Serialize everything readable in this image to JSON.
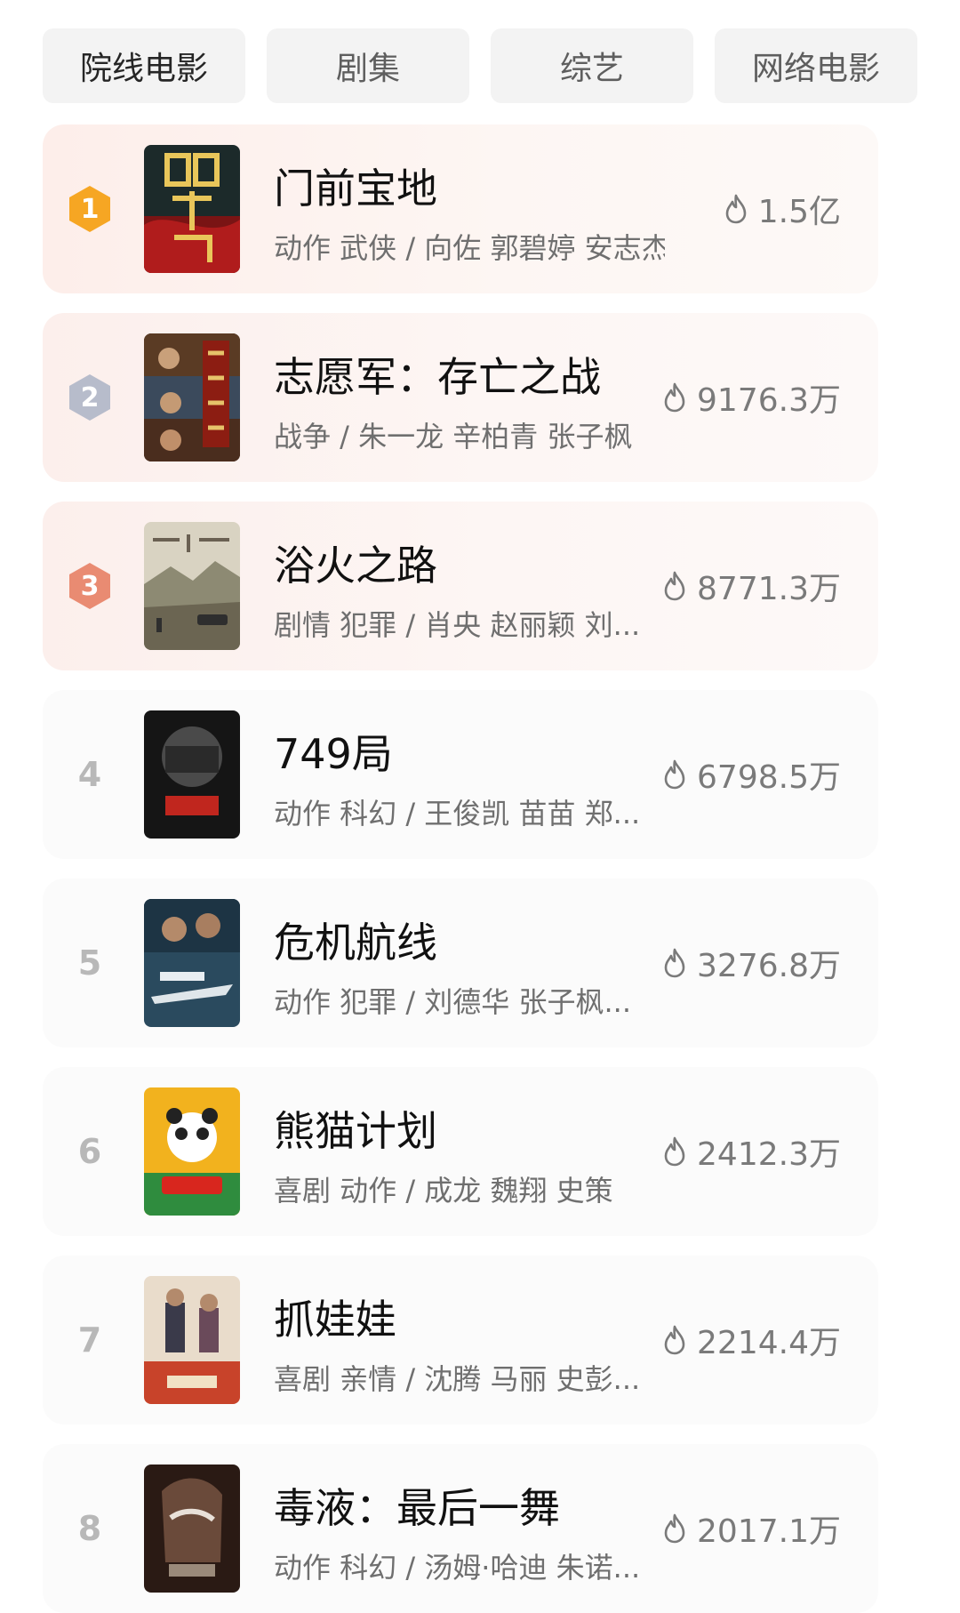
{
  "tabs": [
    {
      "label": "院线电影",
      "active": true
    },
    {
      "label": "剧集",
      "active": false
    },
    {
      "label": "综艺",
      "active": false
    },
    {
      "label": "网络电影",
      "active": false
    }
  ],
  "items": [
    {
      "rank": "1",
      "title": "门前宝地",
      "meta": "动作 武侠 / 向佐 郭碧婷 安志杰",
      "heat": "1.5亿",
      "badge_color": "#f6a623"
    },
    {
      "rank": "2",
      "title": "志愿军：存亡之战",
      "meta": "战争 / 朱一龙 辛柏青 张子枫",
      "heat": "9176.3万",
      "badge_color": "#b7bccb"
    },
    {
      "rank": "3",
      "title": "浴火之路",
      "meta": "剧情 犯罪 / 肖央 赵丽颖 刘...",
      "heat": "8771.3万",
      "badge_color": "#e98b72"
    },
    {
      "rank": "4",
      "title": "749局",
      "meta": "动作 科幻 / 王俊凯 苗苗 郑...",
      "heat": "6798.5万"
    },
    {
      "rank": "5",
      "title": "危机航线",
      "meta": "动作 犯罪 / 刘德华 张子枫...",
      "heat": "3276.8万"
    },
    {
      "rank": "6",
      "title": "熊猫计划",
      "meta": "喜剧 动作 / 成龙 魏翔 史策",
      "heat": "2412.3万"
    },
    {
      "rank": "7",
      "title": "抓娃娃",
      "meta": "喜剧 亲情 / 沈腾 马丽 史彭...",
      "heat": "2214.4万"
    },
    {
      "rank": "8",
      "title": "毒液：最后一舞",
      "meta": "动作 科幻 / 汤姆·哈迪 朱诺...",
      "heat": "2017.1万"
    }
  ],
  "icons": {
    "heat": "flame-icon"
  }
}
